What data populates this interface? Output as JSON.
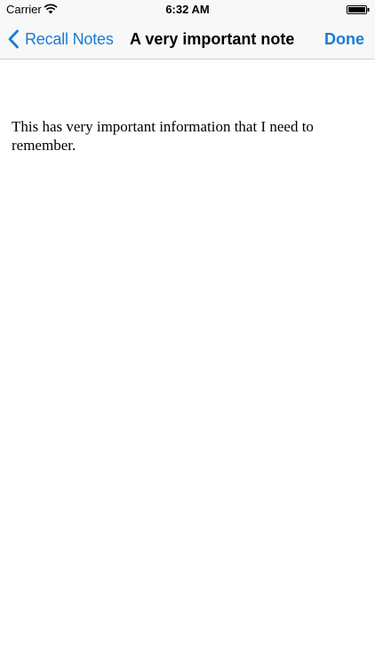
{
  "status_bar": {
    "carrier": "Carrier",
    "time": "6:32 AM",
    "wifi_icon": "wifi-icon",
    "battery_icon": "battery-icon"
  },
  "nav_bar": {
    "back_label": "Recall Notes",
    "back_icon": "chevron-left-icon",
    "title": "A very important note",
    "done_label": "Done",
    "accent_color": "#1a7bd6"
  },
  "note": {
    "body": "This has very important information that I need to remember."
  }
}
